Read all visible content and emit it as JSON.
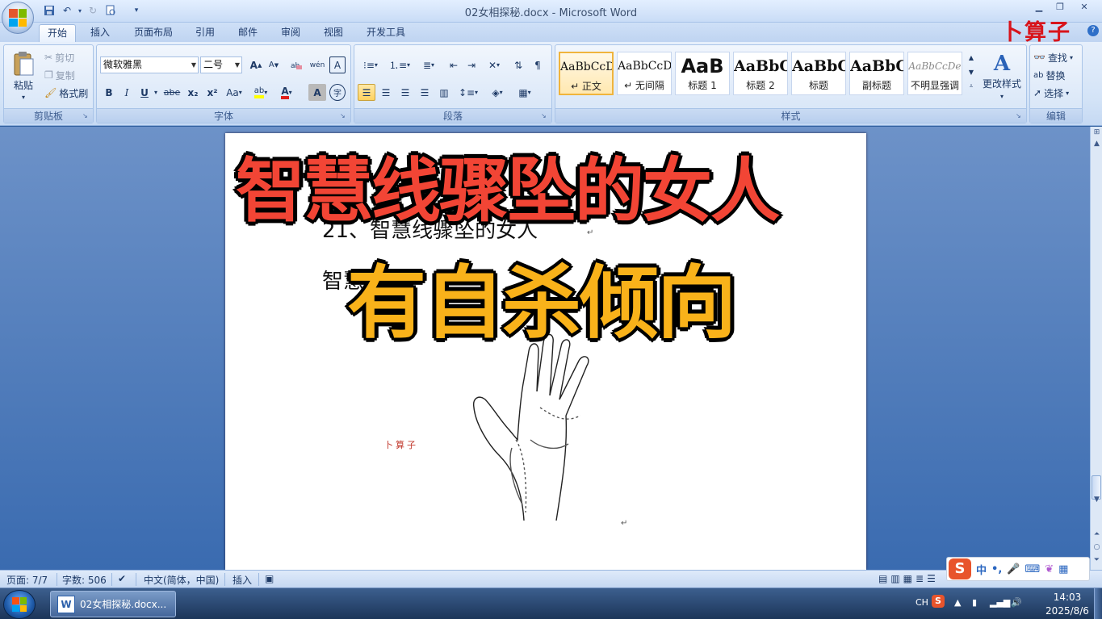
{
  "window": {
    "title": "02女相探秘.docx - Microsoft Word",
    "brand_overlay": "卜算子"
  },
  "quick_access": [
    "save-icon",
    "undo-icon",
    "redo-icon",
    "print-preview-icon"
  ],
  "tabs": [
    {
      "label": "开始",
      "active": true
    },
    {
      "label": "插入"
    },
    {
      "label": "页面布局"
    },
    {
      "label": "引用"
    },
    {
      "label": "邮件"
    },
    {
      "label": "审阅"
    },
    {
      "label": "视图"
    },
    {
      "label": "开发工具"
    }
  ],
  "clipboard": {
    "group_label": "剪贴板",
    "paste": "粘贴",
    "cut": "剪切",
    "copy": "复制",
    "format_painter": "格式刷"
  },
  "font": {
    "group_label": "字体",
    "font_name": "微软雅黑",
    "font_size": "二号",
    "bold": "B",
    "italic": "I",
    "underline": "U",
    "strikethrough": "abe",
    "subscript": "x₂",
    "superscript": "x²",
    "change_case": "Aa",
    "highlight": "ab",
    "font_color": "A",
    "grow": "A",
    "shrink": "A",
    "phonetic": "wén",
    "border_char": "A",
    "shade_char": "A",
    "enclose": "字"
  },
  "paragraph": {
    "group_label": "段落"
  },
  "styles": {
    "group_label": "样式",
    "items": [
      {
        "sample": "AaBbCcD",
        "name": "↵ 正文",
        "selected": true
      },
      {
        "sample": "AaBbCcD",
        "name": "↵ 无间隔"
      },
      {
        "sample": "AaB",
        "name": "标题 1"
      },
      {
        "sample": "AaBbC",
        "name": "标题 2"
      },
      {
        "sample": "AaBbC",
        "name": "标题"
      },
      {
        "sample": "AaBbC",
        "name": "副标题"
      },
      {
        "sample": "AaBbCcDe",
        "name": "不明显强调"
      }
    ],
    "change_styles": "更改样式"
  },
  "editing": {
    "group_label": "编辑",
    "find": "查找",
    "replace": "替换",
    "select": "选择"
  },
  "document": {
    "heading": "21、智慧线骤坠的女人",
    "body_partial": "智慧",
    "stamp": "卜算子"
  },
  "overlay": {
    "line1": "智慧线骤坠的女人",
    "line2": "有自杀倾向"
  },
  "statusbar": {
    "page": "页面: 7/7",
    "words": "字数: 506",
    "language": "中文(简体，中国)",
    "mode": "插入"
  },
  "ime": {
    "lang": "中",
    "punct": "•,"
  },
  "taskbar": {
    "task_label": "02女相探秘.docx...",
    "tray_lang": "CH",
    "time": "14:03",
    "date": "2025/8/6"
  },
  "colors": {
    "caption_red": "#f24535",
    "caption_yellow": "#f9b21a",
    "brand_red": "#d8141b"
  }
}
